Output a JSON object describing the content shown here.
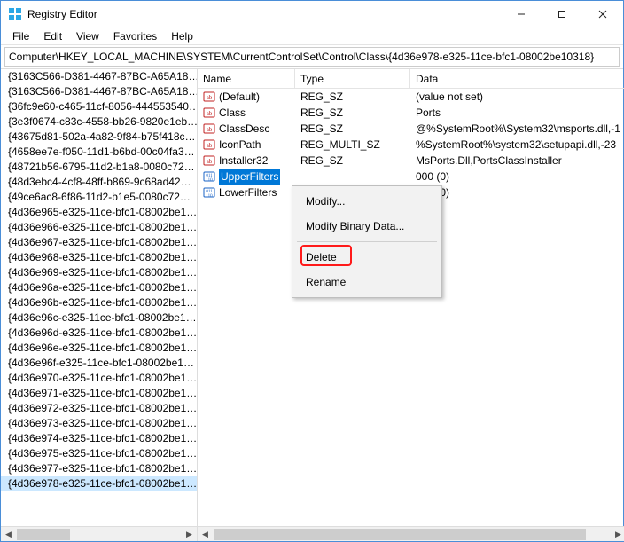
{
  "window": {
    "title": "Registry Editor"
  },
  "menu": {
    "file": "File",
    "edit": "Edit",
    "view": "View",
    "favorites": "Favorites",
    "help": "Help"
  },
  "address": "Computer\\HKEY_LOCAL_MACHINE\\SYSTEM\\CurrentControlSet\\Control\\Class\\{4d36e978-e325-11ce-bfc1-08002be10318}",
  "tree": {
    "items": [
      "{3163C566-D381-4467-87BC-A65A18…",
      "{3163C566-D381-4467-87BC-A65A18…",
      "{36fc9e60-c465-11cf-8056-444553540…",
      "{3e3f0674-c83c-4558-bb26-9820e1eb…",
      "{43675d81-502a-4a82-9f84-b75f418c…",
      "{4658ee7e-f050-11d1-b6bd-00c04fa3…",
      "{48721b56-6795-11d2-b1a8-0080c72…",
      "{48d3ebc4-4cf8-48ff-b869-9c68ad42…",
      "{49ce6ac8-6f86-11d2-b1e5-0080c72…",
      "{4d36e965-e325-11ce-bfc1-08002be1…",
      "{4d36e966-e325-11ce-bfc1-08002be1…",
      "{4d36e967-e325-11ce-bfc1-08002be1…",
      "{4d36e968-e325-11ce-bfc1-08002be1…",
      "{4d36e969-e325-11ce-bfc1-08002be1…",
      "{4d36e96a-e325-11ce-bfc1-08002be1…",
      "{4d36e96b-e325-11ce-bfc1-08002be1…",
      "{4d36e96c-e325-11ce-bfc1-08002be1…",
      "{4d36e96d-e325-11ce-bfc1-08002be1…",
      "{4d36e96e-e325-11ce-bfc1-08002be1…",
      "{4d36e96f-e325-11ce-bfc1-08002be1…",
      "{4d36e970-e325-11ce-bfc1-08002be1…",
      "{4d36e971-e325-11ce-bfc1-08002be1…",
      "{4d36e972-e325-11ce-bfc1-08002be1…",
      "{4d36e973-e325-11ce-bfc1-08002be1…",
      "{4d36e974-e325-11ce-bfc1-08002be1…",
      "{4d36e975-e325-11ce-bfc1-08002be1…",
      "{4d36e977-e325-11ce-bfc1-08002be1…",
      "{4d36e978-e325-11ce-bfc1-08002be1…"
    ],
    "selected_index": 27
  },
  "columns": {
    "name": "Name",
    "type": "Type",
    "data": "Data"
  },
  "values": [
    {
      "icon": "sz",
      "name": "(Default)",
      "type": "REG_SZ",
      "data": "(value not set)"
    },
    {
      "icon": "sz",
      "name": "Class",
      "type": "REG_SZ",
      "data": "Ports"
    },
    {
      "icon": "sz",
      "name": "ClassDesc",
      "type": "REG_SZ",
      "data": "@%SystemRoot%\\System32\\msports.dll,-1"
    },
    {
      "icon": "sz",
      "name": "IconPath",
      "type": "REG_MULTI_SZ",
      "data": "%SystemRoot%\\system32\\setupapi.dll,-23"
    },
    {
      "icon": "sz",
      "name": "Installer32",
      "type": "REG_SZ",
      "data": "MsPorts.Dll,PortsClassInstaller"
    },
    {
      "icon": "bin",
      "name": "UpperFilters",
      "type": "",
      "data": "000 (0)",
      "selected": true
    },
    {
      "icon": "bin",
      "name": "LowerFilters",
      "type": "",
      "data": "000 (0)"
    }
  ],
  "context_menu": {
    "modify": "Modify...",
    "modify_binary": "Modify Binary Data...",
    "delete": "Delete",
    "rename": "Rename"
  }
}
